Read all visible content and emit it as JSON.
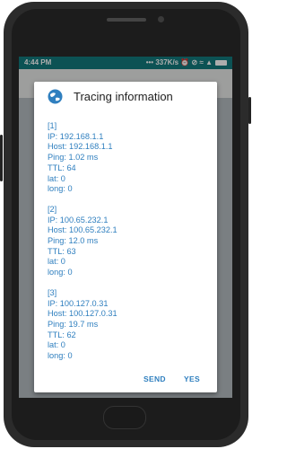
{
  "status_bar": {
    "time": "4:44 PM",
    "indicators": "••• 337K/s ⏰ ⊘ ≈ ▲"
  },
  "dialog": {
    "title": "Tracing information",
    "icon": "globe-icon",
    "entries": [
      {
        "index": "[1]",
        "ip": "IP: 192.168.1.1",
        "host": "Host: 192.168.1.1",
        "ping": "Ping: 1.02 ms",
        "ttl": "TTL: 64",
        "lat": "lat: 0",
        "long": "long: 0"
      },
      {
        "index": "[2]",
        "ip": "IP: 100.65.232.1",
        "host": "Host: 100.65.232.1",
        "ping": "Ping: 12.0 ms",
        "ttl": "TTL: 63",
        "lat": "lat: 0",
        "long": "long: 0"
      },
      {
        "index": "[3]",
        "ip": "IP: 100.127.0.31",
        "host": "Host: 100.127.0.31",
        "ping": "Ping: 19.7 ms",
        "ttl": "TTL: 62",
        "lat": "lat: 0",
        "long": "long: 0"
      }
    ],
    "actions": {
      "send": "SEND",
      "yes": "YES"
    }
  },
  "colors": {
    "status_bar": "#137a7d",
    "accent": "#2f7fbf"
  }
}
